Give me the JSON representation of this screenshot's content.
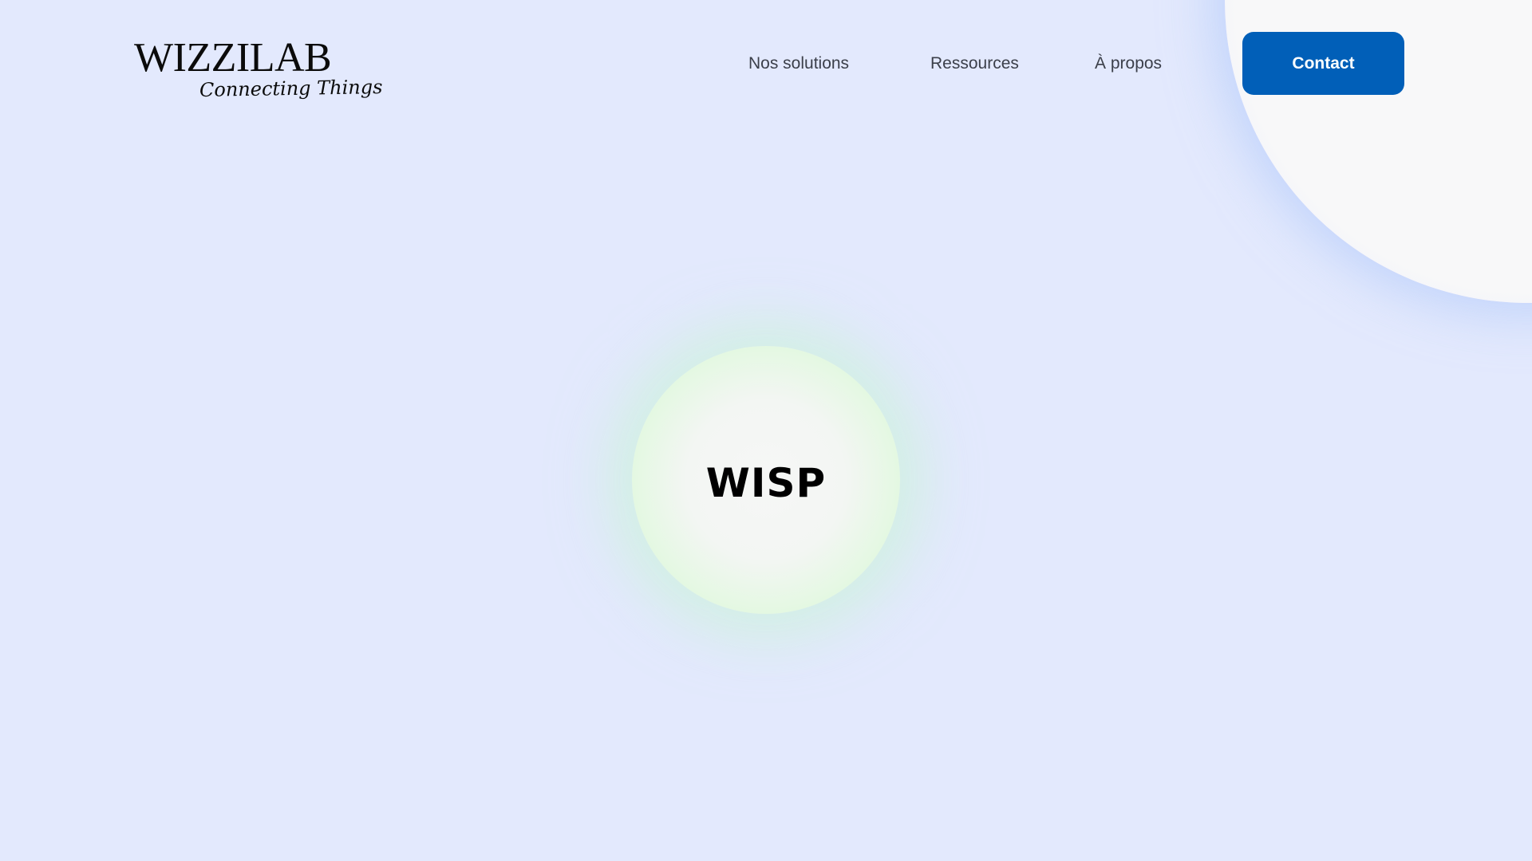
{
  "brand": {
    "name": "WIZZILAB",
    "tagline": "Connecting Things"
  },
  "nav": {
    "items": [
      {
        "label": "Nos solutions"
      },
      {
        "label": "Ressources"
      },
      {
        "label": "À propos"
      }
    ],
    "contact_label": "Contact"
  },
  "hero": {
    "title": "WISP"
  },
  "colors": {
    "background": "#e3e9fd",
    "accent": "#015fb8",
    "nav_text": "#3b3f49",
    "orb_green": "#c9f4c7"
  }
}
